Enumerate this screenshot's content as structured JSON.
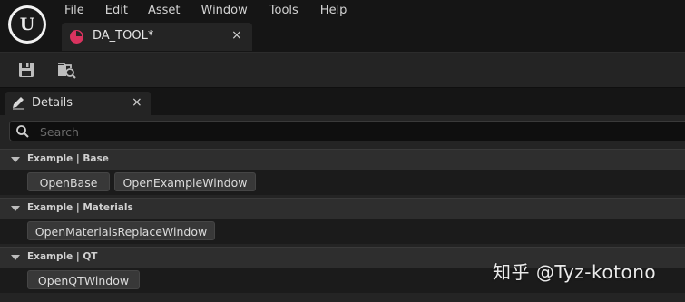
{
  "app": {
    "logo_text": "U"
  },
  "menu": [
    "File",
    "Edit",
    "Asset",
    "Window",
    "Tools",
    "Help"
  ],
  "asset_tab": {
    "label": "DA_TOOL*",
    "close": "×"
  },
  "toolbar": {
    "save_icon": "save-icon",
    "browse_icon": "browse-asset-icon"
  },
  "details_tab": {
    "label": "Details",
    "close": "×",
    "icon": "pencil-icon"
  },
  "search": {
    "placeholder": "Search",
    "value": ""
  },
  "categories": [
    {
      "label": "Example | Base",
      "buttons": [
        "OpenBase",
        "OpenExampleWindow"
      ]
    },
    {
      "label": "Example | Materials",
      "buttons": [
        "OpenMaterialsReplaceWindow"
      ]
    },
    {
      "label": "Example | QT",
      "buttons": [
        "OpenQTWindow"
      ]
    }
  ],
  "watermark": "知乎 @Tyz-kotono",
  "colors": {
    "asset_icon": "#d9335f",
    "panel_bg": "#242424",
    "window_bg": "#151515"
  }
}
